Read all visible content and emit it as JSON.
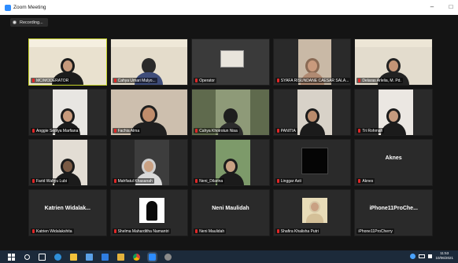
{
  "window": {
    "title": "Zoom Meeting",
    "controls": [
      "–",
      "□"
    ]
  },
  "recording": {
    "label": "Recording..."
  },
  "participants": [
    [
      {
        "name": "MC/MODERATOR",
        "active": true
      },
      {
        "name": "Cahya Umari Mulyo..."
      },
      {
        "name": "Operator"
      },
      {
        "name": "SYAFA RISUNDANE CAESAR SALA..."
      },
      {
        "name": "Delaras Arlelia, M. Pd."
      }
    ],
    [
      {
        "name": "Anggie Septya Marfiana"
      },
      {
        "name": "Fachia Alma"
      },
      {
        "name": "Cahya Khoirotun Nisa"
      },
      {
        "name": "PANITIA"
      },
      {
        "name": "Tri Rohmah"
      }
    ],
    [
      {
        "name": "Farid Wahyu Lubi"
      },
      {
        "name": "Mahfiatul Khasanah"
      },
      {
        "name": "Neni_Dilarina"
      },
      {
        "name": "Linggar Asti"
      },
      {
        "name": "Aknes",
        "display": "Aknes"
      }
    ],
    [
      {
        "name": "Katrien Widalakshita",
        "display": "Katrien  Widalak..."
      },
      {
        "name": "Shelma Maharditha Namantri"
      },
      {
        "name": "Neni Maulidah",
        "display": "Neni Maulidah"
      },
      {
        "name": "Shafira Khalisha Putri"
      },
      {
        "name": "iPhone11ProCherry",
        "display": "iPhone11ProChe..."
      }
    ]
  ],
  "taskbar": {
    "icons": [
      "start-icon",
      "search-icon",
      "task-view-icon",
      "edge-icon",
      "file-explorer-icon",
      "store-icon",
      "dropbox-icon",
      "slack-icon",
      "chrome-icon",
      "zoom-icon",
      "settings-icon"
    ],
    "time": "11:53",
    "date": "10/06/2021"
  }
}
